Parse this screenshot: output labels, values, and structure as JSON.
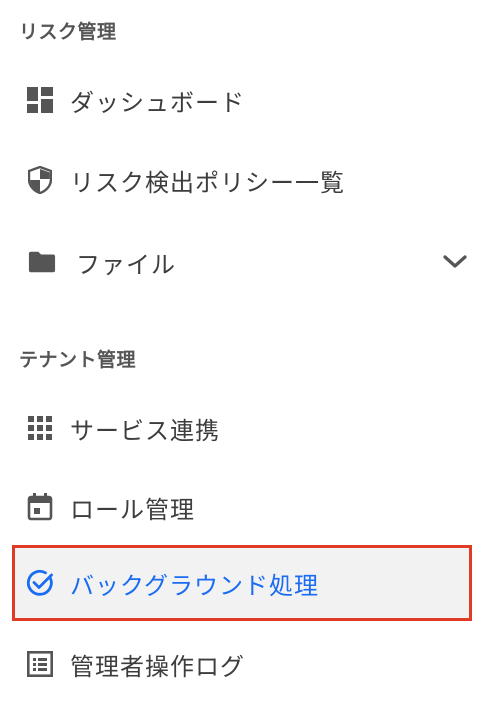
{
  "sections": {
    "risk": {
      "header": "リスク管理",
      "items": {
        "dashboard": "ダッシュボード",
        "policy_list": "リスク検出ポリシー一覧",
        "files": "ファイル"
      }
    },
    "tenant": {
      "header": "テナント管理",
      "items": {
        "service_integration": "サービス連携",
        "role_management": "ロール管理",
        "background_processing": "バックグラウンド処理",
        "admin_log": "管理者操作ログ"
      }
    }
  },
  "colors": {
    "active_text": "#1a6cf2",
    "active_border": "#e03b24",
    "active_bg": "#f2f2f2",
    "icon": "#555555"
  },
  "icons": {
    "dashboard": "dashboard-icon",
    "policy_list": "shield-icon",
    "files": "folder-icon",
    "files_expand": "chevron-down-icon",
    "service_integration": "apps-grid-icon",
    "role_management": "calendar-icon",
    "background_processing": "check-circle-icon",
    "admin_log": "list-icon"
  }
}
